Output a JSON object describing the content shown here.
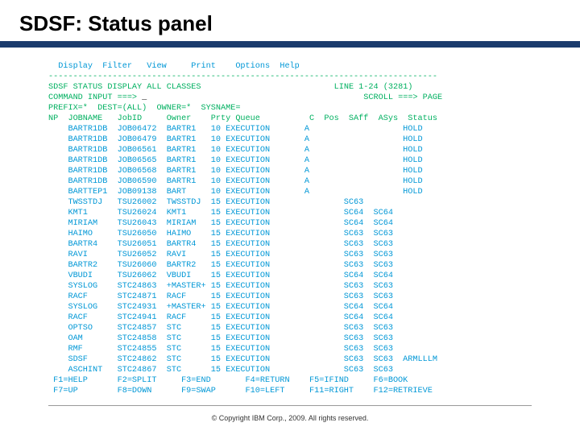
{
  "title": "SDSF: Status panel",
  "menu": [
    "Display",
    "Filter",
    "View",
    "Print",
    "Options",
    "Help"
  ],
  "status_line": "SDSF STATUS DISPLAY ALL CLASSES",
  "status_right": "LINE 1-24 (3281)",
  "cmd_label": "COMMAND INPUT ===>",
  "scroll_label": "SCROLL ===> PAGE",
  "filters": {
    "prefix": "PREFIX=*",
    "dest": "DEST=(ALL)",
    "owner": "OWNER=*",
    "sysname": "SYSNAME="
  },
  "columns": [
    "NP",
    "JOBNAME",
    "JobID",
    "Owner",
    "Prty",
    "Queue",
    "C",
    "Pos",
    "SAff",
    "ASys",
    "Status"
  ],
  "rows": [
    {
      "j": "BARTR1DB",
      "id": "JOB06472",
      "ow": "BARTR1",
      "p": "10",
      "q": "EXECUTION",
      "c": "A",
      "pos": "",
      "s": "",
      "a": "",
      "st": "HOLD"
    },
    {
      "j": "BARTR1DB",
      "id": "JOB06479",
      "ow": "BARTR1",
      "p": "10",
      "q": "EXECUTION",
      "c": "A",
      "pos": "",
      "s": "",
      "a": "",
      "st": "HOLD"
    },
    {
      "j": "BARTR1DB",
      "id": "JOB06561",
      "ow": "BARTR1",
      "p": "10",
      "q": "EXECUTION",
      "c": "A",
      "pos": "",
      "s": "",
      "a": "",
      "st": "HOLD"
    },
    {
      "j": "BARTR1DB",
      "id": "JOB06565",
      "ow": "BARTR1",
      "p": "10",
      "q": "EXECUTION",
      "c": "A",
      "pos": "",
      "s": "",
      "a": "",
      "st": "HOLD"
    },
    {
      "j": "BARTR1DB",
      "id": "JOB06568",
      "ow": "BARTR1",
      "p": "10",
      "q": "EXECUTION",
      "c": "A",
      "pos": "",
      "s": "",
      "a": "",
      "st": "HOLD"
    },
    {
      "j": "BARTR1DB",
      "id": "JOB06590",
      "ow": "BARTR1",
      "p": "10",
      "q": "EXECUTION",
      "c": "A",
      "pos": "",
      "s": "",
      "a": "",
      "st": "HOLD"
    },
    {
      "j": "BARTTEP1",
      "id": "JOB09138",
      "ow": "BART",
      "p": "10",
      "q": "EXECUTION",
      "c": "A",
      "pos": "",
      "s": "",
      "a": "",
      "st": "HOLD"
    },
    {
      "j": "TWSSTDJ",
      "id": "TSU26002",
      "ow": "TWSSTDJ",
      "p": "15",
      "q": "EXECUTION",
      "c": "",
      "pos": "",
      "s": "SC63",
      "a": "",
      "st": ""
    },
    {
      "j": "KMT1",
      "id": "TSU26024",
      "ow": "KMT1",
      "p": "15",
      "q": "EXECUTION",
      "c": "",
      "pos": "",
      "s": "SC64",
      "a": "SC64",
      "st": ""
    },
    {
      "j": "MIRIAM",
      "id": "TSU26043",
      "ow": "MIRIAM",
      "p": "15",
      "q": "EXECUTION",
      "c": "",
      "pos": "",
      "s": "SC64",
      "a": "SC64",
      "st": ""
    },
    {
      "j": "HAIMO",
      "id": "TSU26050",
      "ow": "HAIMO",
      "p": "15",
      "q": "EXECUTION",
      "c": "",
      "pos": "",
      "s": "SC63",
      "a": "SC63",
      "st": ""
    },
    {
      "j": "BARTR4",
      "id": "TSU26051",
      "ow": "BARTR4",
      "p": "15",
      "q": "EXECUTION",
      "c": "",
      "pos": "",
      "s": "SC63",
      "a": "SC63",
      "st": ""
    },
    {
      "j": "RAVI",
      "id": "TSU26052",
      "ow": "RAVI",
      "p": "15",
      "q": "EXECUTION",
      "c": "",
      "pos": "",
      "s": "SC63",
      "a": "SC63",
      "st": ""
    },
    {
      "j": "BARTR2",
      "id": "TSU26060",
      "ow": "BARTR2",
      "p": "15",
      "q": "EXECUTION",
      "c": "",
      "pos": "",
      "s": "SC63",
      "a": "SC63",
      "st": ""
    },
    {
      "j": "VBUDI",
      "id": "TSU26062",
      "ow": "VBUDI",
      "p": "15",
      "q": "EXECUTION",
      "c": "",
      "pos": "",
      "s": "SC64",
      "a": "SC64",
      "st": ""
    },
    {
      "j": "SYSLOG",
      "id": "STC24863",
      "ow": "+MASTER+",
      "p": "15",
      "q": "EXECUTION",
      "c": "",
      "pos": "",
      "s": "SC63",
      "a": "SC63",
      "st": ""
    },
    {
      "j": "RACF",
      "id": "STC24871",
      "ow": "RACF",
      "p": "15",
      "q": "EXECUTION",
      "c": "",
      "pos": "",
      "s": "SC63",
      "a": "SC63",
      "st": ""
    },
    {
      "j": "SYSLOG",
      "id": "STC24931",
      "ow": "+MASTER+",
      "p": "15",
      "q": "EXECUTION",
      "c": "",
      "pos": "",
      "s": "SC64",
      "a": "SC64",
      "st": ""
    },
    {
      "j": "RACF",
      "id": "STC24941",
      "ow": "RACF",
      "p": "15",
      "q": "EXECUTION",
      "c": "",
      "pos": "",
      "s": "SC64",
      "a": "SC64",
      "st": ""
    },
    {
      "j": "OPTSO",
      "id": "STC24857",
      "ow": "STC",
      "p": "15",
      "q": "EXECUTION",
      "c": "",
      "pos": "",
      "s": "SC63",
      "a": "SC63",
      "st": ""
    },
    {
      "j": "OAM",
      "id": "STC24858",
      "ow": "STC",
      "p": "15",
      "q": "EXECUTION",
      "c": "",
      "pos": "",
      "s": "SC63",
      "a": "SC63",
      "st": ""
    },
    {
      "j": "RMF",
      "id": "STC24855",
      "ow": "STC",
      "p": "15",
      "q": "EXECUTION",
      "c": "",
      "pos": "",
      "s": "SC63",
      "a": "SC63",
      "st": ""
    },
    {
      "j": "SDSF",
      "id": "STC24862",
      "ow": "STC",
      "p": "15",
      "q": "EXECUTION",
      "c": "",
      "pos": "",
      "s": "SC63",
      "a": "SC63",
      "st": "ARMLLLM"
    },
    {
      "j": "ASCHINT",
      "id": "STC24867",
      "ow": "STC",
      "p": "15",
      "q": "EXECUTION",
      "c": "",
      "pos": "",
      "s": "SC63",
      "a": "SC63",
      "st": ""
    }
  ],
  "fkeys": [
    {
      "k": "F1=HELP"
    },
    {
      "k": "F2=SPLIT"
    },
    {
      "k": "F3=END"
    },
    {
      "k": "F4=RETURN"
    },
    {
      "k": "F5=IFIND"
    },
    {
      "k": "F6=BOOK"
    },
    {
      "k": "F7=UP"
    },
    {
      "k": "F8=DOWN"
    },
    {
      "k": "F9=SWAP"
    },
    {
      "k": "F10=LEFT"
    },
    {
      "k": "F11=RIGHT"
    },
    {
      "k": "F12=RETRIEVE"
    }
  ],
  "copyright": "© Copyright IBM Corp., 2009. All rights reserved."
}
